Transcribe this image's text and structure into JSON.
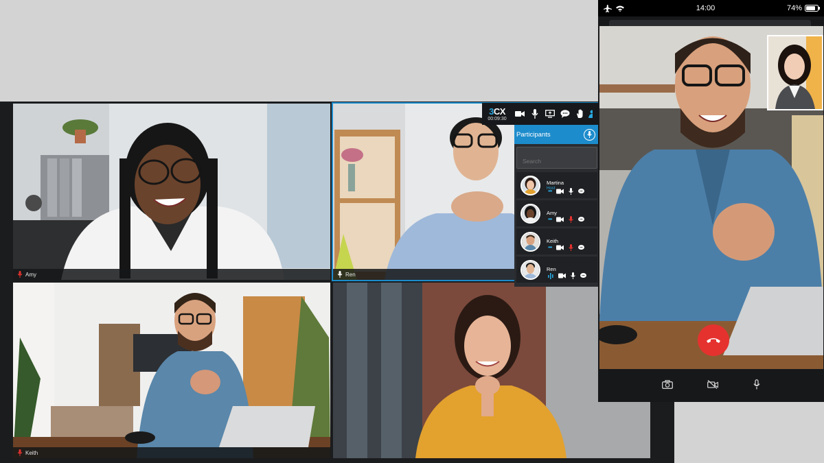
{
  "toolbar": {
    "brand_prefix": "3",
    "brand_suffix": "CX",
    "timer": "00:09:30",
    "icons": [
      "camera-icon",
      "mic-icon",
      "share-screen-icon",
      "chat-icon",
      "raise-hand-icon",
      "people-icon"
    ]
  },
  "tiles": [
    {
      "name": "Amy",
      "mic": "muted"
    },
    {
      "name": "Ren",
      "mic": "on"
    },
    {
      "name": "Keith",
      "mic": "muted"
    },
    {
      "name": "",
      "mic": ""
    }
  ],
  "participants": {
    "title": "Participants",
    "search_placeholder": "Search",
    "items": [
      {
        "name": "Martina",
        "role": "Host",
        "mic": "on"
      },
      {
        "name": "Amy",
        "role": "",
        "mic": "muted"
      },
      {
        "name": "Keith",
        "role": "",
        "mic": "muted"
      },
      {
        "name": "Ren",
        "role": "",
        "mic": "on"
      }
    ]
  },
  "phone": {
    "time": "14:00",
    "battery": "74%",
    "icons": [
      "airplane-icon",
      "wifi-icon",
      "battery-icon",
      "end-call-icon",
      "switch-camera-icon",
      "video-off-icon",
      "mic-icon"
    ]
  },
  "colors": {
    "accent": "#1d8ccc",
    "muted_red": "#e5322f",
    "background": "#d3d3d3"
  }
}
